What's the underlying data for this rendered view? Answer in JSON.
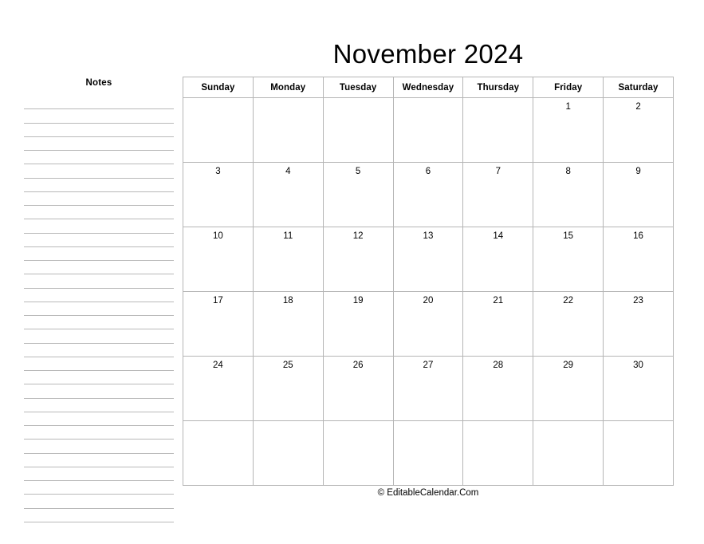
{
  "notes": {
    "title": "Notes",
    "line_count": 31
  },
  "calendar": {
    "title": "November 2024",
    "month": "November",
    "year": "2024",
    "weekday_headers": [
      "Sunday",
      "Monday",
      "Tuesday",
      "Wednesday",
      "Thursday",
      "Friday",
      "Saturday"
    ],
    "weekend_column_indices": [
      0,
      6
    ],
    "weekend_shade_color": "#d7d7d7",
    "grid_line_color": "#b5b5b5",
    "weeks": [
      [
        "",
        "",
        "",
        "",
        "",
        "1",
        "2"
      ],
      [
        "3",
        "4",
        "5",
        "6",
        "7",
        "8",
        "9"
      ],
      [
        "10",
        "11",
        "12",
        "13",
        "14",
        "15",
        "16"
      ],
      [
        "17",
        "18",
        "19",
        "20",
        "21",
        "22",
        "23"
      ],
      [
        "24",
        "25",
        "26",
        "27",
        "28",
        "29",
        "30"
      ],
      [
        "",
        "",
        "",
        "",
        "",
        "",
        ""
      ]
    ]
  },
  "footer": {
    "text": "© EditableCalendar.Com"
  }
}
